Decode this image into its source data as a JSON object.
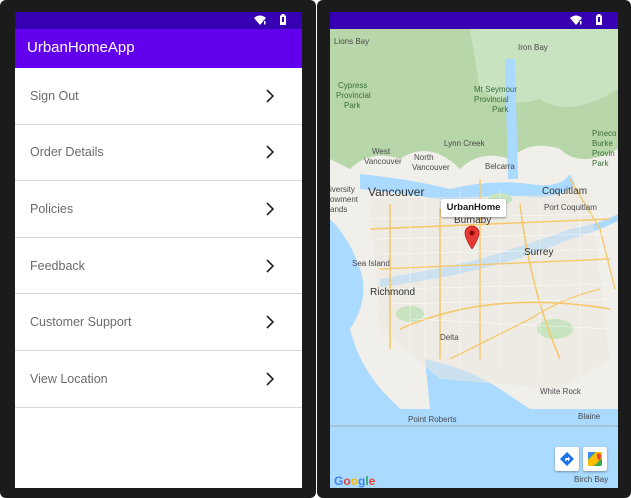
{
  "app": {
    "title": "UrbanHomeApp"
  },
  "menu": {
    "items": [
      {
        "label": "Sign Out"
      },
      {
        "label": "Order Details"
      },
      {
        "label": "Policies"
      },
      {
        "label": "Feedback"
      },
      {
        "label": "Customer Support"
      },
      {
        "label": "View Location"
      }
    ]
  },
  "map": {
    "marker_title": "UrbanHome",
    "attribution": "Google",
    "labels": {
      "lions_bay": "Lions Bay",
      "iron_bay": "Iron Bay",
      "cypress": "Cypress",
      "provincial": "Provincial",
      "park": "Park",
      "mt_seymour": "Mt Seymour",
      "mt_provincial": "Provincial",
      "mt_park": "Park",
      "pinecone": "Pineco",
      "burke": "Burke",
      "provin": "Provin",
      "park2": "Park",
      "lynn_creek": "Lynn Creek",
      "west_vancouver_1": "West",
      "west_vancouver_2": "Vancouver",
      "north_vancouver_1": "North",
      "north_vancouver_2": "Vancouver",
      "belcarra": "Belcarra",
      "university_1": "iversity",
      "university_2": "owment",
      "university_3": "ands",
      "vancouver": "Vancouver",
      "coquitlam": "Coquitlam",
      "port_coquitlam": "Port Coquitlam",
      "burnaby": "Burnaby",
      "sea_island": "Sea Island",
      "surrey": "Surrey",
      "richmond": "Richmond",
      "delta": "Delta",
      "white_rock": "White Rock",
      "point_roberts": "Point Roberts",
      "blaine": "Blaine",
      "birch_bay": "Birch Bay"
    },
    "colors": {
      "water": "#aadaff",
      "land": "#f1efe9",
      "park": "#c7e3c0",
      "mountain": "#b7d6a9",
      "road": "#f5c86b",
      "marker": "#e53935"
    }
  },
  "status": {
    "wifi_icon": "wifi-icon",
    "battery_icon": "battery-icon"
  }
}
